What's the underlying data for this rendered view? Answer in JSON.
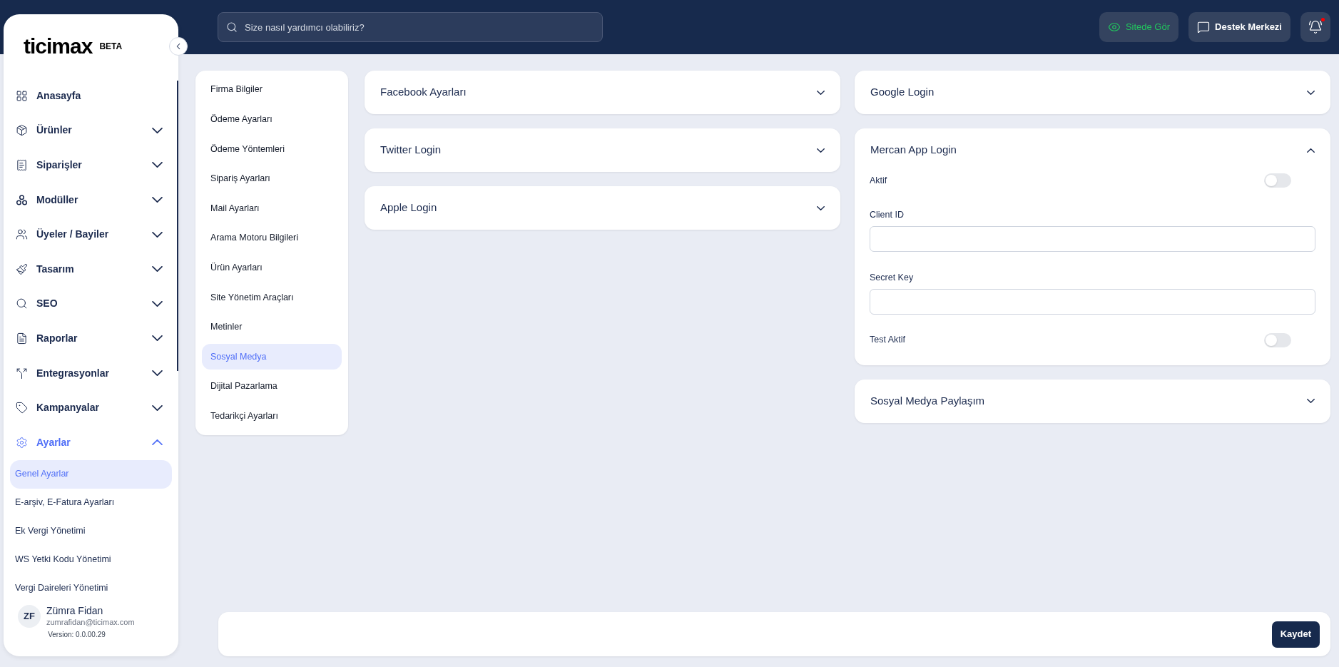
{
  "logo": {
    "wordmark": "ticimax",
    "badge": "BETA"
  },
  "sidebar": {
    "items": [
      {
        "kind": "link",
        "label": "Anasayfa"
      },
      {
        "kind": "group",
        "label": "Ürünler",
        "expanded": false
      },
      {
        "kind": "group",
        "label": "Siparişler",
        "expanded": false
      },
      {
        "kind": "group",
        "label": "Modüller",
        "expanded": false
      },
      {
        "kind": "group",
        "label": "Üyeler / Bayiler",
        "expanded": false
      },
      {
        "kind": "group",
        "label": "Tasarım",
        "expanded": false
      },
      {
        "kind": "group",
        "label": "SEO",
        "expanded": false
      },
      {
        "kind": "group",
        "label": "Raporlar",
        "expanded": false
      },
      {
        "kind": "group",
        "label": "Entegrasyonlar",
        "expanded": false
      },
      {
        "kind": "group",
        "label": "Kampanyalar",
        "expanded": false
      },
      {
        "kind": "group",
        "label": "Ayarlar",
        "expanded": true,
        "children": [
          {
            "label": "Genel Ayarlar",
            "selected": true
          },
          {
            "label": "E-arşiv, E-Fatura Ayarları",
            "selected": false
          },
          {
            "label": "Ek Vergi Yönetimi",
            "selected": false
          },
          {
            "label": "WS Yetki Kodu Yönetimi",
            "selected": false
          },
          {
            "label": "Vergi Daireleri Yönetimi",
            "selected": false
          }
        ]
      }
    ],
    "user": {
      "initials": "ZF",
      "name": "Zümra Fidan",
      "email": "zumrafidan@ticimax.com",
      "version": "Version: 0.0.00.29"
    }
  },
  "search": {
    "placeholder": "Size nasıl yardımcı olabiliriz?"
  },
  "header_actions": [
    {
      "kind": "view",
      "label": "Sitede Gör"
    },
    {
      "kind": "support",
      "label": "Destek Merkezi"
    }
  ],
  "notifications": {
    "unread": true
  },
  "settings_menu": {
    "items": [
      {
        "label": "Firma Bilgiler",
        "selected": false
      },
      {
        "label": "Ödeme Ayarları",
        "selected": false
      },
      {
        "label": "Ödeme Yöntemleri",
        "selected": false
      },
      {
        "label": "Sipariş Ayarları",
        "selected": false
      },
      {
        "label": "Mail Ayarları",
        "selected": false
      },
      {
        "label": "Arama Motoru Bilgileri",
        "selected": false
      },
      {
        "label": "Ürün Ayarları",
        "selected": false
      },
      {
        "label": "Site Yönetim Araçları",
        "selected": false
      },
      {
        "label": "Metinler",
        "selected": false
      },
      {
        "label": "Sosyal Medya",
        "selected": true
      },
      {
        "label": "Dijital Pazarlama",
        "selected": false
      },
      {
        "label": "Tedarikçi Ayarları",
        "selected": false
      }
    ]
  },
  "panels_left": [
    {
      "title": "Facebook Ayarları",
      "expanded": false
    },
    {
      "title": "Twitter Login",
      "expanded": false
    },
    {
      "title": "Apple Login",
      "expanded": false
    }
  ],
  "panels_right": [
    {
      "title": "Google Login",
      "expanded": false
    },
    {
      "title": "Mercan App Login",
      "expanded": true,
      "fields": [
        {
          "kind": "toggle",
          "label": "Aktif",
          "on": false
        },
        {
          "kind": "text",
          "label": "Client ID"
        },
        {
          "kind": "text",
          "label": "Secret Key"
        },
        {
          "kind": "toggle",
          "label": "Test Aktif",
          "on": false
        }
      ]
    },
    {
      "title": "Sosyal Medya Paylaşım",
      "expanded": false
    }
  ],
  "footer": {
    "save_button": "Kaydet"
  }
}
